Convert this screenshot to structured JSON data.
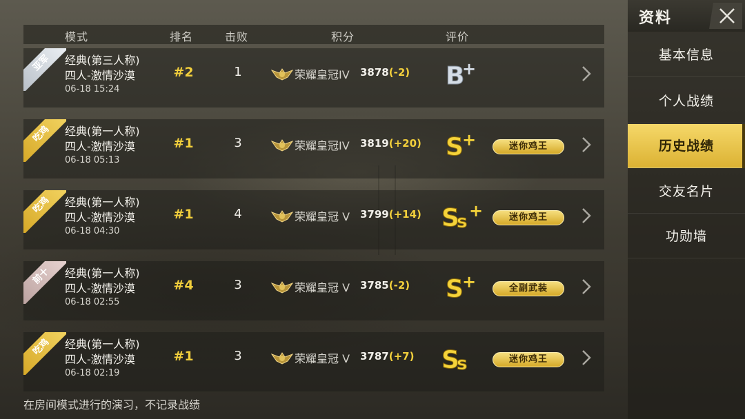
{
  "table": {
    "headers": {
      "mode": "模式",
      "rank": "排名",
      "kills": "击败",
      "score": "积分",
      "rating": "评价"
    },
    "rows": [
      {
        "tag": "亚军",
        "tag_style": "silver",
        "mode_line1": "经典(第三人称)",
        "mode_line2": "四人-激情沙漠",
        "time": "06-18 15:24",
        "rank": "#2",
        "kills": "1",
        "tier_name": "荣耀皇冠IV",
        "tier_roman": "IV",
        "score": "3878",
        "delta": "(-2)",
        "grade": "B+",
        "badge": ""
      },
      {
        "tag": "吃鸡",
        "tag_style": "gold",
        "mode_line1": "经典(第一人称)",
        "mode_line2": "四人-激情沙漠",
        "time": "06-18 05:13",
        "rank": "#1",
        "kills": "3",
        "tier_name": "荣耀皇冠IV",
        "tier_roman": "IV",
        "score": "3819",
        "delta": "(+20)",
        "grade": "S+",
        "badge": "迷你鸡王"
      },
      {
        "tag": "吃鸡",
        "tag_style": "gold",
        "mode_line1": "经典(第一人称)",
        "mode_line2": "四人-激情沙漠",
        "time": "06-18 04:30",
        "rank": "#1",
        "kills": "4",
        "tier_name": "荣耀皇冠 V",
        "tier_roman": "V",
        "score": "3799",
        "delta": "(+14)",
        "grade": "SS+",
        "badge": "迷你鸡王"
      },
      {
        "tag": "前十",
        "tag_style": "pink",
        "mode_line1": "经典(第一人称)",
        "mode_line2": "四人-激情沙漠",
        "time": "06-18 02:55",
        "rank": "#4",
        "kills": "3",
        "tier_name": "荣耀皇冠 V",
        "tier_roman": "V",
        "score": "3785",
        "delta": "(-2)",
        "grade": "S+",
        "badge": "全副武装"
      },
      {
        "tag": "吃鸡",
        "tag_style": "gold",
        "mode_line1": "经典(第一人称)",
        "mode_line2": "四人-激情沙漠",
        "time": "06-18 02:19",
        "rank": "#1",
        "kills": "3",
        "tier_name": "荣耀皇冠 V",
        "tier_roman": "V",
        "score": "3787",
        "delta": "(+7)",
        "grade": "SS",
        "badge": "迷你鸡王"
      }
    ]
  },
  "footer_note": "在房间模式进行的演习，不记录战绩",
  "sidebar": {
    "title": "资料",
    "items": [
      {
        "label": "基本信息",
        "active": false
      },
      {
        "label": "个人战绩",
        "active": false
      },
      {
        "label": "历史战绩",
        "active": true
      },
      {
        "label": "交友名片",
        "active": false
      },
      {
        "label": "功勋墙",
        "active": false
      }
    ]
  },
  "colors": {
    "accent_gold": "#f2cf3c",
    "active_tab": "#e8c54a",
    "grade_silver": "#c9d4e0",
    "grade_gold": "#f3cf3a"
  },
  "icons": {
    "close": "close-icon",
    "chevron": "chevron-right-icon",
    "tier": "crown-wings-icon"
  }
}
